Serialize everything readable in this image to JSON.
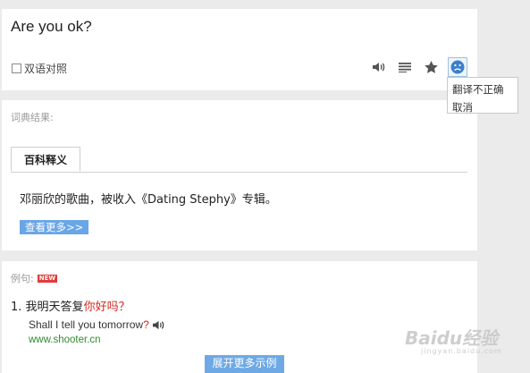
{
  "query": "Are you ok?",
  "bilingual": {
    "label": "双语对照",
    "checked": false
  },
  "toolbar": {
    "icons": [
      "speaker-icon",
      "list-icon",
      "star-icon",
      "sad-face-icon"
    ]
  },
  "feedback_menu": {
    "items": [
      "翻译不正确",
      "取消"
    ]
  },
  "dictionary": {
    "section_label": "词典结果:",
    "tab": "百科释义",
    "text": "邓丽欣的歌曲，被收入《Dating Stephy》专辑。",
    "more_button": "查看更多>>"
  },
  "examples": {
    "section_label": "例句:",
    "badge": "NEW",
    "items": [
      {
        "index": "1.",
        "zh_prefix": "我明天答复",
        "zh_highlight": "你好吗？",
        "en_prefix": "Shall I tell you tomorrow",
        "en_highlight": "?",
        "source": "www.shooter.cn"
      }
    ],
    "expand_button": "展开更多示例"
  },
  "watermark": {
    "text": "Baidu经验",
    "sub": "jingyan.baidu.com"
  },
  "colors": {
    "accent_blue": "#69a6e6",
    "highlight_red": "#d2281f",
    "source_green": "#2e8b2e",
    "badge_red": "#e13b3b"
  }
}
